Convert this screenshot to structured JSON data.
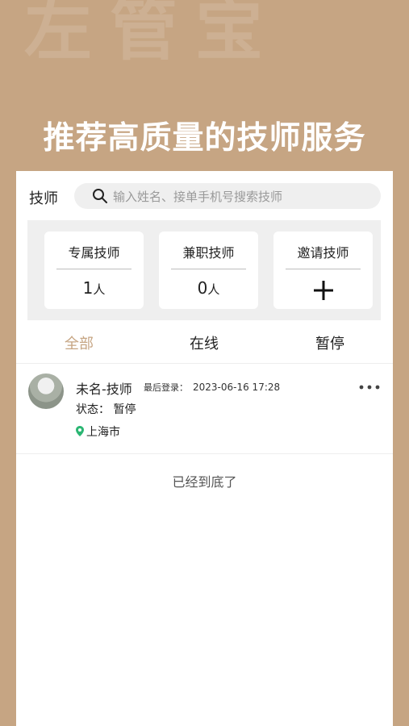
{
  "background_watermark": "左管宝",
  "headline": "推荐高质量的技师服务",
  "topbar": {
    "title": "技师",
    "search_placeholder": "输入姓名、接单手机号搜索技师"
  },
  "stats": [
    {
      "label": "专属技师",
      "value": "1",
      "unit": "人"
    },
    {
      "label": "兼职技师",
      "value": "0",
      "unit": "人"
    },
    {
      "label": "邀请技师",
      "action": "plus-icon"
    }
  ],
  "tabs": [
    {
      "label": "全部",
      "active": true
    },
    {
      "label": "在线",
      "active": false
    },
    {
      "label": "暂停",
      "active": false
    }
  ],
  "technicians": [
    {
      "name": "未名-技师",
      "last_login_label": "最后登录：",
      "last_login": "2023-06-16 17:28",
      "status": "状态：  暂停",
      "city": "上海市"
    }
  ],
  "end_text": "已经到底了",
  "colors": {
    "brand": "#c6a583",
    "location_pin": "#2bb673"
  }
}
